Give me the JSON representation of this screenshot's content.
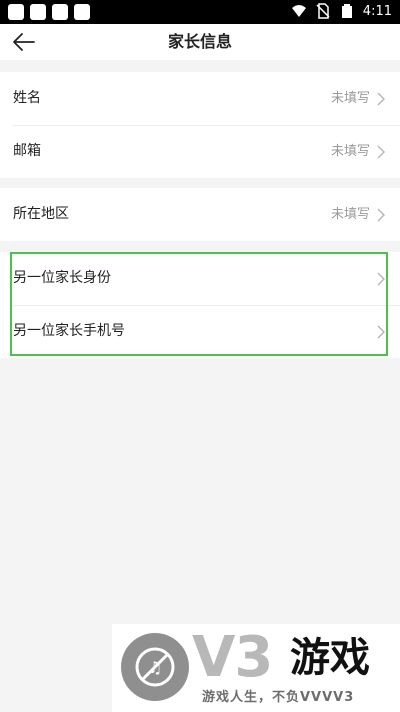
{
  "status_bar": {
    "time": "4:11"
  },
  "app_bar": {
    "title": "家长信息"
  },
  "sections": {
    "basic": [
      {
        "label": "姓名",
        "value": "未填写"
      },
      {
        "label": "邮箱",
        "value": "未填写"
      }
    ],
    "region": [
      {
        "label": "所在地区",
        "value": "未填写"
      }
    ],
    "other_parent": [
      {
        "label": "另一位家长身份"
      },
      {
        "label": "另一位家长手机号"
      }
    ]
  },
  "colors": {
    "highlight": "#4cc24b",
    "secondary_text": "#9a9a9a",
    "background": "#f4f4f4"
  },
  "watermark": {
    "brand": "V3",
    "brand_cn": "游戏",
    "slogan": "游戏人生，不负VVVV3"
  }
}
